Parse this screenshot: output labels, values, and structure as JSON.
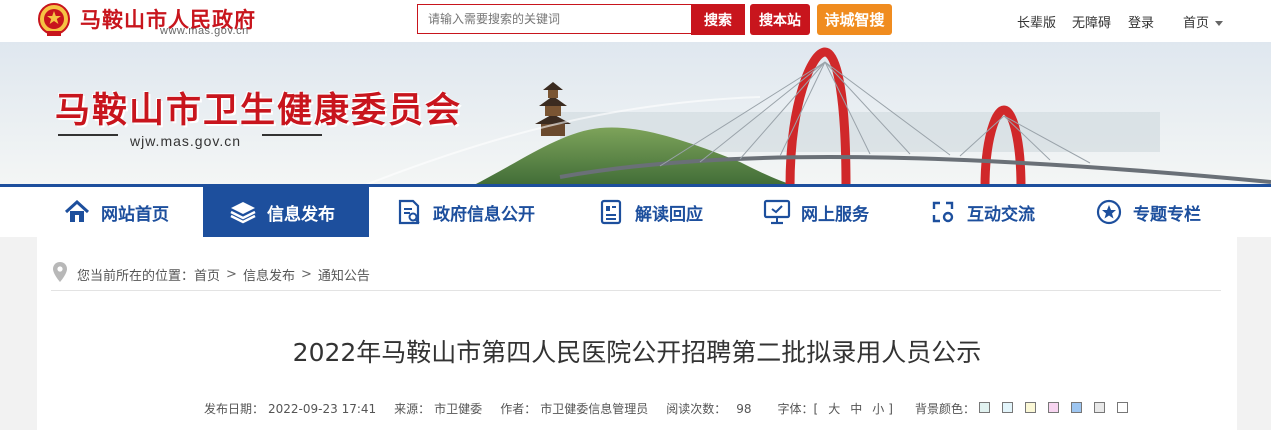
{
  "header": {
    "site_name": "马鞍山市人民政府",
    "site_url": "www.mas.gov.cn",
    "search_placeholder": "请输入需要搜索的关键词",
    "search_label": "搜索",
    "site_search_label": "搜本站",
    "smart_search_label": "诗城智搜",
    "links": {
      "elder": "长辈版",
      "accessible": "无障碍",
      "login": "登录",
      "home": "首页"
    }
  },
  "banner": {
    "title": "马鞍山市卫生健康委员会",
    "url": "wjw.mas.gov.cn"
  },
  "nav": {
    "items": [
      {
        "label": "网站首页",
        "icon": "home-icon"
      },
      {
        "label": "信息发布",
        "icon": "layers-icon"
      },
      {
        "label": "政府信息公开",
        "icon": "document-icon"
      },
      {
        "label": "解读回应",
        "icon": "book-icon"
      },
      {
        "label": "网上服务",
        "icon": "monitor-icon"
      },
      {
        "label": "互动交流",
        "icon": "interaction-icon"
      },
      {
        "label": "专题专栏",
        "icon": "star-icon"
      }
    ],
    "active_index": 1
  },
  "breadcrumb": {
    "prefix": "您当前所在的位置：",
    "items": [
      "首页",
      "信息发布",
      "通知公告"
    ]
  },
  "article": {
    "title": "2022年马鞍山市第四人民医院公开招聘第二批拟录用人员公示",
    "meta": {
      "date_label": "发布日期：",
      "date": "2022-09-23 17:41",
      "source_label": "来源：",
      "source": "市卫健委",
      "author_label": "作者：",
      "author": "市卫健委信息管理员",
      "views_label": "阅读次数：",
      "views": "98",
      "font_label": "字体：[",
      "font_large": "大",
      "font_medium": "中",
      "font_small": "小",
      "font_close": "]",
      "bg_label": "背景颜色："
    },
    "bg_colors": [
      "#e1f2f0",
      "#e3f5fb",
      "#fbf8d6",
      "#f8d5f1",
      "#9ec6f1",
      "#e8e8e8",
      "#ffffff"
    ]
  },
  "colors": {
    "brand_red": "#c8151d",
    "brand_blue": "#1d4f9d",
    "orange": "#f08c1f"
  }
}
